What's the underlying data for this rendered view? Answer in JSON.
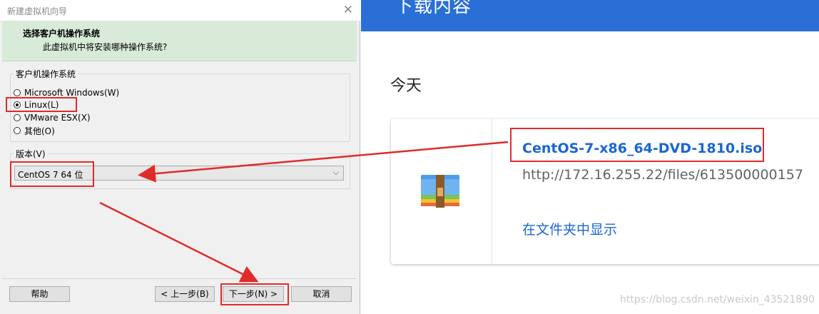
{
  "wizard": {
    "title": "新建虚拟机向导",
    "close_glyph": "✕",
    "header": {
      "title": "选择客户机操作系统",
      "subtitle": "此虚拟机中将安装哪种操作系统?"
    },
    "os_group": {
      "label": "客户机操作系统",
      "options": [
        {
          "label": "Microsoft Windows(W)",
          "checked": false
        },
        {
          "label": "Linux(L)",
          "checked": true
        },
        {
          "label": "VMware ESX(X)",
          "checked": false
        },
        {
          "label": "其他(O)",
          "checked": false
        }
      ]
    },
    "version_group": {
      "label": "版本(V)",
      "selected": "CentOS 7 64 位"
    },
    "buttons": {
      "help": "帮助",
      "back": "< 上一步(B)",
      "next": "下一步(N) >",
      "cancel": "取消"
    }
  },
  "downloads": {
    "header_title": "下载内容",
    "section_label": "今天",
    "item": {
      "filename": "CentOS-7-x86_64-DVD-1810.iso",
      "url": "http://172.16.255.22/files/613500000157",
      "action": "在文件夹中显示",
      "icon": "archive-icon"
    }
  },
  "watermark": "https://blog.csdn.net/weixin_43521890",
  "colors": {
    "annotation": "#e02b2b",
    "header_green": "#d8ebd8",
    "download_blue": "#2a6fd6",
    "link_blue": "#1a67d2"
  }
}
